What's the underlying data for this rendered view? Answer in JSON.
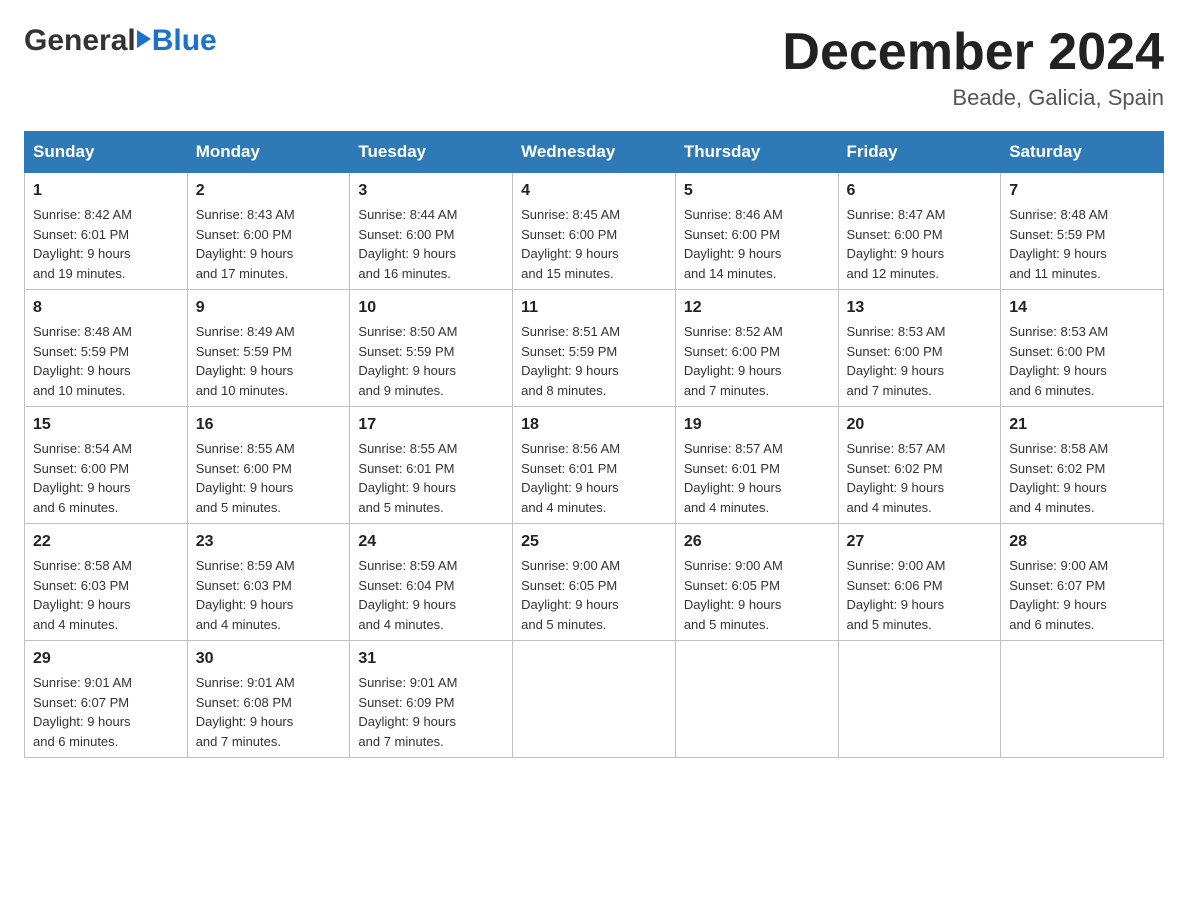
{
  "header": {
    "logo_general": "General",
    "logo_blue": "Blue",
    "month_title": "December 2024",
    "subtitle": "Beade, Galicia, Spain"
  },
  "weekdays": [
    "Sunday",
    "Monday",
    "Tuesday",
    "Wednesday",
    "Thursday",
    "Friday",
    "Saturday"
  ],
  "weeks": [
    [
      {
        "day": "1",
        "info": "Sunrise: 8:42 AM\nSunset: 6:01 PM\nDaylight: 9 hours\nand 19 minutes."
      },
      {
        "day": "2",
        "info": "Sunrise: 8:43 AM\nSunset: 6:00 PM\nDaylight: 9 hours\nand 17 minutes."
      },
      {
        "day": "3",
        "info": "Sunrise: 8:44 AM\nSunset: 6:00 PM\nDaylight: 9 hours\nand 16 minutes."
      },
      {
        "day": "4",
        "info": "Sunrise: 8:45 AM\nSunset: 6:00 PM\nDaylight: 9 hours\nand 15 minutes."
      },
      {
        "day": "5",
        "info": "Sunrise: 8:46 AM\nSunset: 6:00 PM\nDaylight: 9 hours\nand 14 minutes."
      },
      {
        "day": "6",
        "info": "Sunrise: 8:47 AM\nSunset: 6:00 PM\nDaylight: 9 hours\nand 12 minutes."
      },
      {
        "day": "7",
        "info": "Sunrise: 8:48 AM\nSunset: 5:59 PM\nDaylight: 9 hours\nand 11 minutes."
      }
    ],
    [
      {
        "day": "8",
        "info": "Sunrise: 8:48 AM\nSunset: 5:59 PM\nDaylight: 9 hours\nand 10 minutes."
      },
      {
        "day": "9",
        "info": "Sunrise: 8:49 AM\nSunset: 5:59 PM\nDaylight: 9 hours\nand 10 minutes."
      },
      {
        "day": "10",
        "info": "Sunrise: 8:50 AM\nSunset: 5:59 PM\nDaylight: 9 hours\nand 9 minutes."
      },
      {
        "day": "11",
        "info": "Sunrise: 8:51 AM\nSunset: 5:59 PM\nDaylight: 9 hours\nand 8 minutes."
      },
      {
        "day": "12",
        "info": "Sunrise: 8:52 AM\nSunset: 6:00 PM\nDaylight: 9 hours\nand 7 minutes."
      },
      {
        "day": "13",
        "info": "Sunrise: 8:53 AM\nSunset: 6:00 PM\nDaylight: 9 hours\nand 7 minutes."
      },
      {
        "day": "14",
        "info": "Sunrise: 8:53 AM\nSunset: 6:00 PM\nDaylight: 9 hours\nand 6 minutes."
      }
    ],
    [
      {
        "day": "15",
        "info": "Sunrise: 8:54 AM\nSunset: 6:00 PM\nDaylight: 9 hours\nand 6 minutes."
      },
      {
        "day": "16",
        "info": "Sunrise: 8:55 AM\nSunset: 6:00 PM\nDaylight: 9 hours\nand 5 minutes."
      },
      {
        "day": "17",
        "info": "Sunrise: 8:55 AM\nSunset: 6:01 PM\nDaylight: 9 hours\nand 5 minutes."
      },
      {
        "day": "18",
        "info": "Sunrise: 8:56 AM\nSunset: 6:01 PM\nDaylight: 9 hours\nand 4 minutes."
      },
      {
        "day": "19",
        "info": "Sunrise: 8:57 AM\nSunset: 6:01 PM\nDaylight: 9 hours\nand 4 minutes."
      },
      {
        "day": "20",
        "info": "Sunrise: 8:57 AM\nSunset: 6:02 PM\nDaylight: 9 hours\nand 4 minutes."
      },
      {
        "day": "21",
        "info": "Sunrise: 8:58 AM\nSunset: 6:02 PM\nDaylight: 9 hours\nand 4 minutes."
      }
    ],
    [
      {
        "day": "22",
        "info": "Sunrise: 8:58 AM\nSunset: 6:03 PM\nDaylight: 9 hours\nand 4 minutes."
      },
      {
        "day": "23",
        "info": "Sunrise: 8:59 AM\nSunset: 6:03 PM\nDaylight: 9 hours\nand 4 minutes."
      },
      {
        "day": "24",
        "info": "Sunrise: 8:59 AM\nSunset: 6:04 PM\nDaylight: 9 hours\nand 4 minutes."
      },
      {
        "day": "25",
        "info": "Sunrise: 9:00 AM\nSunset: 6:05 PM\nDaylight: 9 hours\nand 5 minutes."
      },
      {
        "day": "26",
        "info": "Sunrise: 9:00 AM\nSunset: 6:05 PM\nDaylight: 9 hours\nand 5 minutes."
      },
      {
        "day": "27",
        "info": "Sunrise: 9:00 AM\nSunset: 6:06 PM\nDaylight: 9 hours\nand 5 minutes."
      },
      {
        "day": "28",
        "info": "Sunrise: 9:00 AM\nSunset: 6:07 PM\nDaylight: 9 hours\nand 6 minutes."
      }
    ],
    [
      {
        "day": "29",
        "info": "Sunrise: 9:01 AM\nSunset: 6:07 PM\nDaylight: 9 hours\nand 6 minutes."
      },
      {
        "day": "30",
        "info": "Sunrise: 9:01 AM\nSunset: 6:08 PM\nDaylight: 9 hours\nand 7 minutes."
      },
      {
        "day": "31",
        "info": "Sunrise: 9:01 AM\nSunset: 6:09 PM\nDaylight: 9 hours\nand 7 minutes."
      },
      {
        "day": "",
        "info": ""
      },
      {
        "day": "",
        "info": ""
      },
      {
        "day": "",
        "info": ""
      },
      {
        "day": "",
        "info": ""
      }
    ]
  ]
}
